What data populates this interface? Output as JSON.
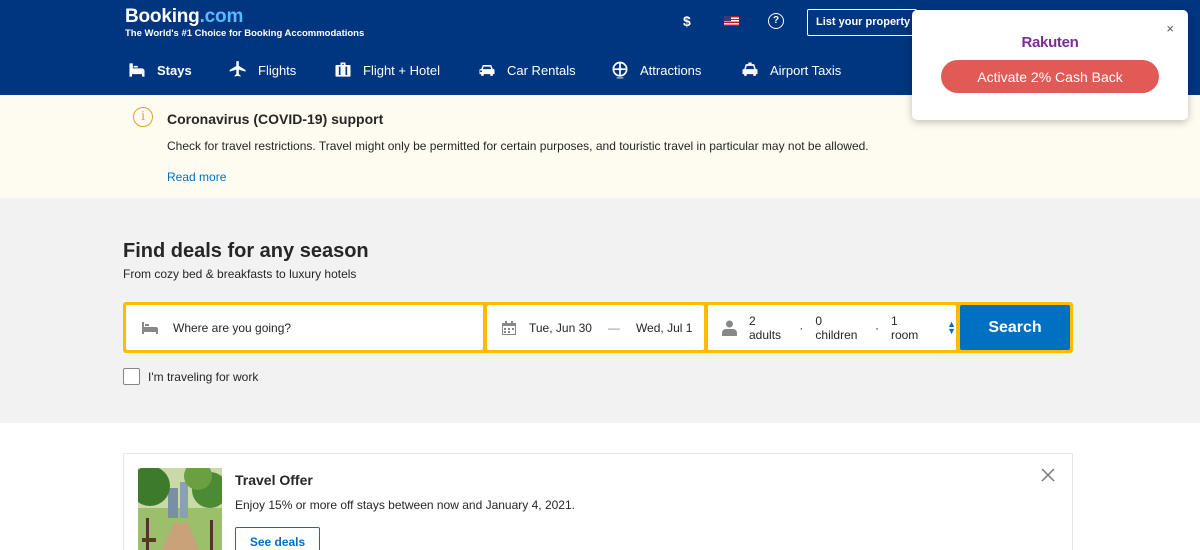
{
  "header": {
    "logo_main": "Booking",
    "logo_suffix": ".com",
    "tagline": "The World's #1 Choice for Booking Accommodations",
    "currency": "$",
    "help": "?",
    "list_property": "List your property"
  },
  "nav": [
    {
      "label": "Stays",
      "icon": "bed-icon",
      "active": true
    },
    {
      "label": "Flights",
      "icon": "plane-icon"
    },
    {
      "label": "Flight + Hotel",
      "icon": "suitcase-icon"
    },
    {
      "label": "Car Rentals",
      "icon": "car-icon"
    },
    {
      "label": "Attractions",
      "icon": "ferris-wheel-icon"
    },
    {
      "label": "Airport Taxis",
      "icon": "taxi-icon"
    }
  ],
  "covid": {
    "icon": "i",
    "title": "Coronavirus (COVID-19) support",
    "text": "Check for travel restrictions. Travel might only be permitted for certain purposes, and touristic travel in particular may not be allowed.",
    "link": "Read more"
  },
  "search": {
    "title": "Find deals for any season",
    "subtitle": "From cozy bed & breakfasts to luxury hotels",
    "destination_placeholder": "Where are you going?",
    "checkin": "Tue, Jun 30",
    "date_separator": "—",
    "checkout": "Wed, Jul 1",
    "adults": "2 adults",
    "children": "0 children",
    "rooms": "1 room",
    "guest_separator": "·",
    "button": "Search",
    "work_label": "I'm traveling for work",
    "work_checked": false
  },
  "offer": {
    "title": "Travel Offer",
    "text": "Enjoy 15% or more off stays between now and January 4, 2021.",
    "button": "See deals"
  },
  "rakuten": {
    "logo": "Rakuten",
    "close": "×",
    "button": "Activate 2% Cash Back"
  },
  "colors": {
    "brand_blue": "#003580",
    "accent_blue": "#0071c2",
    "search_border": "#febb02",
    "rakuten_button": "#e05a56"
  }
}
